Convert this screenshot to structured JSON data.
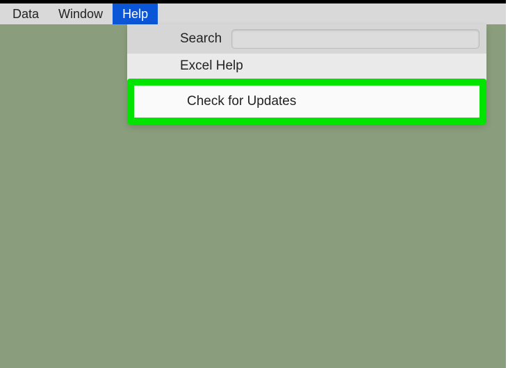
{
  "menubar": {
    "items": [
      {
        "label": "Data",
        "active": false
      },
      {
        "label": "Window",
        "active": false
      },
      {
        "label": "Help",
        "active": true
      }
    ]
  },
  "dropdown": {
    "search_label": "Search",
    "search_value": "",
    "items": [
      {
        "label": "Excel Help",
        "highlighted": false
      },
      {
        "label": "Check for Updates",
        "highlighted": true
      }
    ]
  },
  "colors": {
    "highlight": "#00e400",
    "menu_active_bg": "#0a56d6",
    "desktop_bg": "#8a9e7d"
  }
}
